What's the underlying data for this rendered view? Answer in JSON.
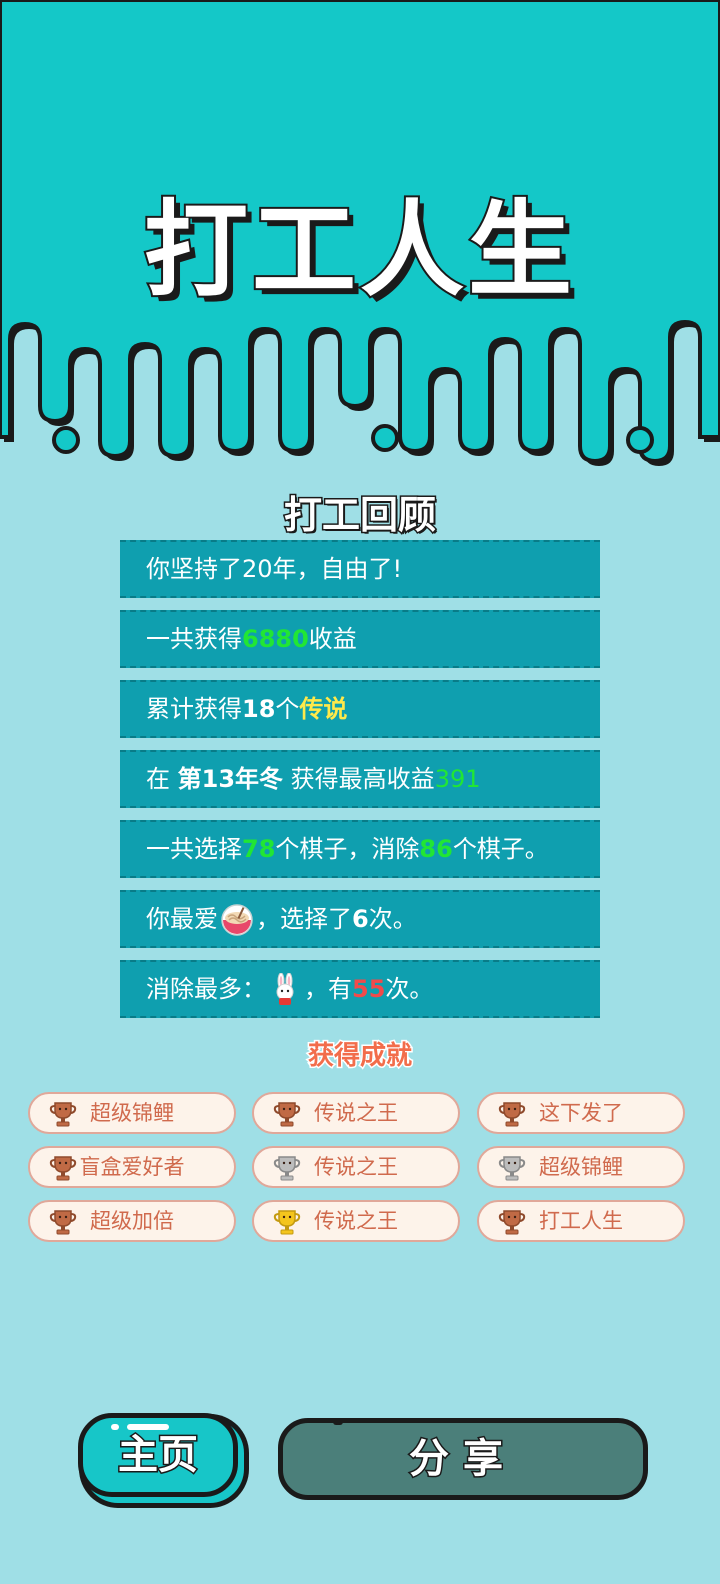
{
  "game_title": "打工人生",
  "review": {
    "title": "打工回顾",
    "row1": {
      "text": "你坚持了20年，自由了!"
    },
    "row2": {
      "pre": "一共获得",
      "value": "6880",
      "post": "收益"
    },
    "row3": {
      "pre": "累计获得",
      "count": "18",
      "unit": "个",
      "rarity": "传说"
    },
    "row4": {
      "pre": "在 ",
      "period": "第13年冬",
      "mid": " 获得最高收益",
      "value": "391"
    },
    "row5": {
      "pre": "一共选择",
      "chosen": "78",
      "mid": "个棋子，消除",
      "eliminated": "86",
      "post": "个棋子。"
    },
    "row6": {
      "pre": "你最爱",
      "icon": "noodle-bowl-icon",
      "mid": "，选择了",
      "times": "6",
      "post": "次。"
    },
    "row7": {
      "pre": "消除最多：",
      "icon": "rabbit-icon",
      "mid": "，有",
      "times": "55",
      "post": "次。"
    }
  },
  "achievements": {
    "title": "获得成就",
    "items": [
      {
        "label": "超级锦鲤",
        "trophy": "bronze"
      },
      {
        "label": "传说之王",
        "trophy": "bronze"
      },
      {
        "label": "这下发了",
        "trophy": "bronze"
      },
      {
        "label": "盲盒爱好者",
        "trophy": "bronze"
      },
      {
        "label": "传说之王",
        "trophy": "silver"
      },
      {
        "label": "超级锦鲤",
        "trophy": "silver"
      },
      {
        "label": "超级加倍",
        "trophy": "bronze"
      },
      {
        "label": "传说之王",
        "trophy": "gold"
      },
      {
        "label": "打工人生",
        "trophy": "bronze"
      }
    ]
  },
  "buttons": {
    "home": "主页",
    "share": "分享"
  },
  "colors": {
    "header": "#14c8c8",
    "background": "#9fdfe6",
    "row": "#0f9faf",
    "green": "#21e634",
    "yellow": "#ffe94a",
    "red": "#f24a4a",
    "bronze": "#c06a45",
    "silver": "#b7b7b7",
    "gold": "#f4c51d"
  }
}
